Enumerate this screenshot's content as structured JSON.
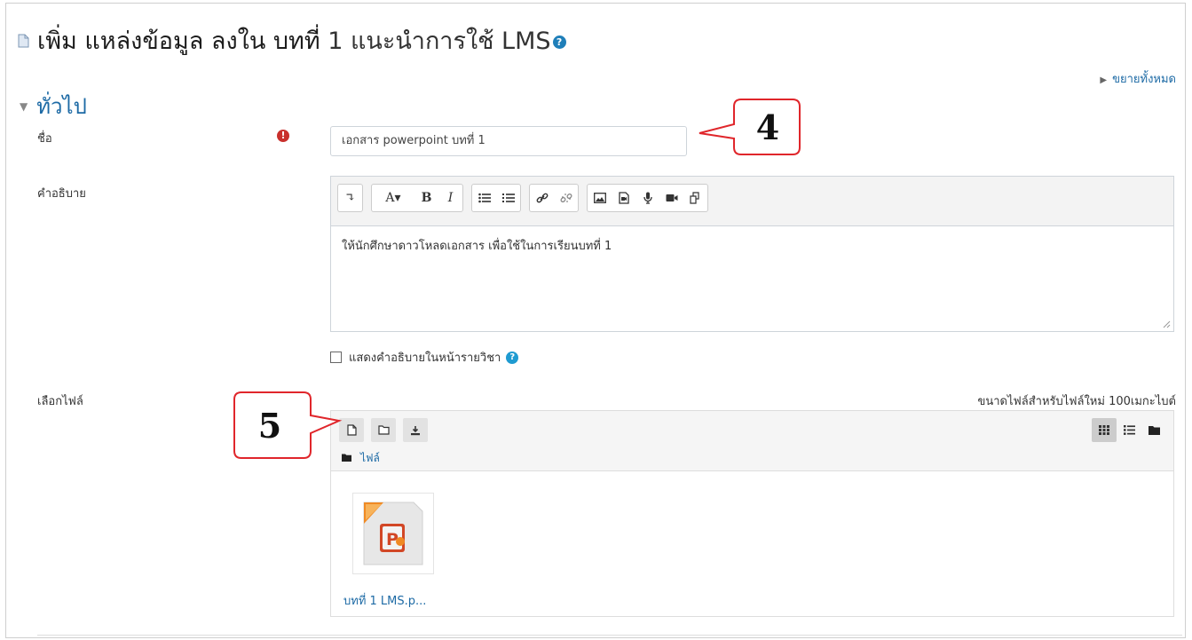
{
  "page": {
    "title_main": "เพิ่ม แหล่งข้อมูล ลงใน บทที่",
    "title_light": "1 แนะนำการใช้ LMS",
    "help_glyph": "?",
    "expand_all": "ขยายทั้งหมด"
  },
  "section": {
    "heading": "ทั่วไป"
  },
  "form": {
    "name_label": "ชื่อ",
    "name_required_glyph": "!",
    "name_value": "เอกสาร powerpoint บทที่ 1",
    "description_label": "คำอธิบาย",
    "description_text": "ให้นักศึกษาดาวโหลดเอกสาร เพื่อใช้ในการเรียนบทที่ 1",
    "show_description_label": "แสดงคำอธิบายในหน้ารายวิชา",
    "select_files_label": "เลือกไฟล์",
    "max_file_size": "ขนาดไฟล์สำหรับไฟล์ใหม่ 100เมกะไบต์"
  },
  "editor_toolbar": {
    "bold": "B",
    "italic": "I",
    "font_color": "A▾"
  },
  "file_manager": {
    "path_label": "ไฟล์",
    "file_name": "บทที่ 1 LMS.p..."
  },
  "callouts": {
    "name_step": "4",
    "file_step": "5"
  }
}
